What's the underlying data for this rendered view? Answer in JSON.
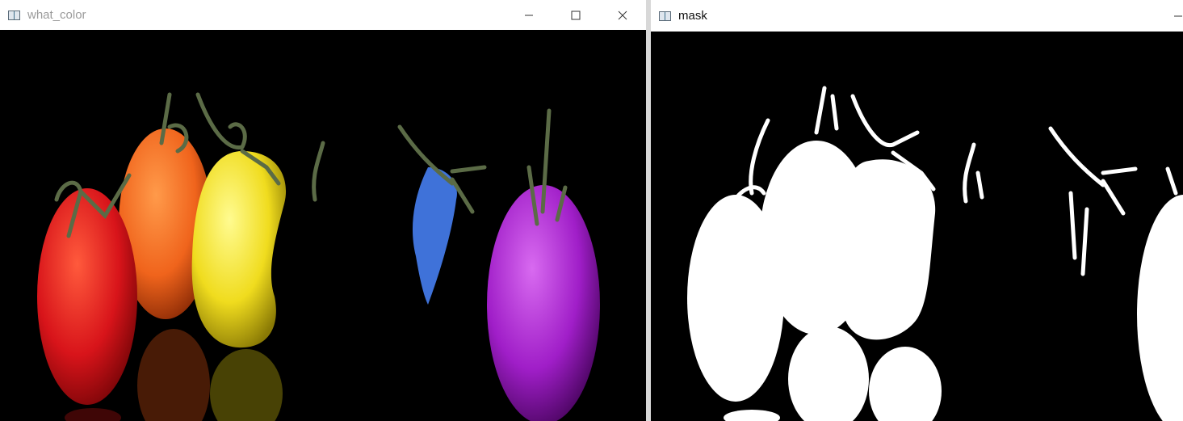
{
  "windows": [
    {
      "title": "what_color",
      "icon": "opencv-window-icon",
      "controls": [
        "minimize-icon",
        "maximize-icon",
        "close-icon"
      ]
    },
    {
      "title": "mask",
      "icon": "opencv-window-icon",
      "controls": [
        "minimize-icon"
      ]
    }
  ],
  "colors": {
    "red": "#d8141a",
    "orange": "#f0641c",
    "yellow": "#f0dc1e",
    "blue": "#4a86ff",
    "purple": "#a01ec8",
    "stem": "#5b6b46",
    "mask_white": "#ffffff",
    "background": "#000000"
  }
}
